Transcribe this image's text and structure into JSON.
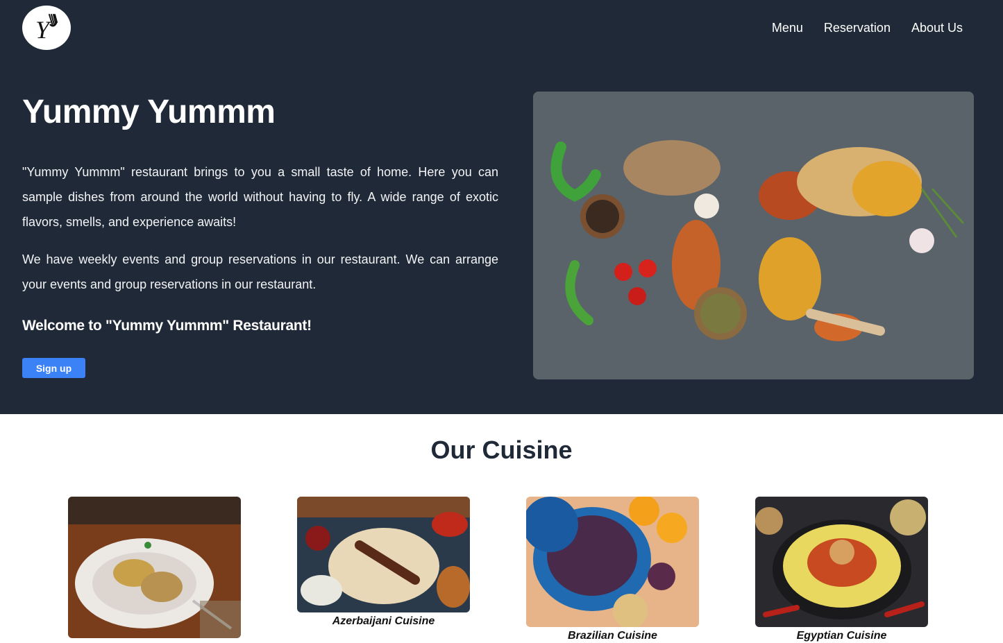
{
  "brand": {
    "logo_icon": "fork-y-logo-icon"
  },
  "nav": {
    "items": [
      {
        "label": "Menu"
      },
      {
        "label": "Reservation"
      },
      {
        "label": "About Us"
      }
    ]
  },
  "hero": {
    "title": "Yummy Yummm",
    "paragraph1": "\"Yummy Yummm\" restaurant brings to you a small taste of home. Here you can sample dishes from around the world without having to fly. A wide range of exotic flavors, smells, and experience awaits!",
    "paragraph2": "We have weekly events and group reservations in our restaurant. We can arrange your events and group reservations in our restaurant.",
    "welcome": "Welcome to \"Yummy Yummm\" Restaurant!",
    "signup_label": "Sign up",
    "accent_color": "#3b82f6",
    "background_color": "#1f2937"
  },
  "cuisine": {
    "title": "Our Cuisine",
    "cards": [
      {
        "label": ""
      },
      {
        "label": "Azerbaijani Cuisine"
      },
      {
        "label": "Brazilian Cuisine"
      },
      {
        "label": "Egyptian Cuisine"
      }
    ]
  }
}
